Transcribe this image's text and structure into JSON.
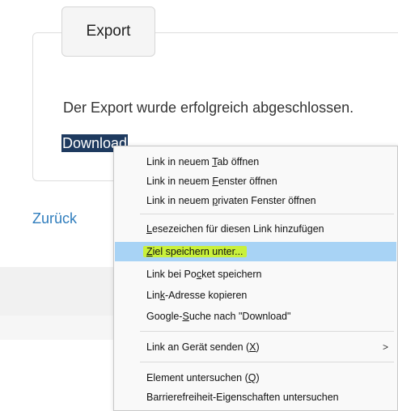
{
  "export_card": {
    "tab_label": "Export",
    "message": "Der Export wurde erfolgreich abgeschlossen.",
    "download_link": "Download"
  },
  "back_link": "Zurück",
  "context_menu": {
    "items": [
      {
        "before": "Link in neuem ",
        "accel": "T",
        "after": "ab öffnen"
      },
      {
        "before": "Link in neuem ",
        "accel": "F",
        "after": "enster öffnen"
      },
      {
        "before": "Link in neuem ",
        "accel": "p",
        "after": "rivaten Fenster öffnen"
      },
      {
        "before": "",
        "accel": "L",
        "after": "esezeichen für diesen Link hinzufügen"
      },
      {
        "before": "",
        "accel": "Z",
        "after": "iel speichern unter..."
      },
      {
        "before": "Link bei Po",
        "accel": "c",
        "after": "ket speichern"
      },
      {
        "before": "Lin",
        "accel": "k",
        "after": "-Adresse kopieren"
      },
      {
        "before": "Google-",
        "accel": "S",
        "after": "uche nach \"Download\""
      },
      {
        "before": "Link an Gerät senden (",
        "accel": "X",
        "after": ")"
      },
      {
        "before": "Element untersuchen (",
        "accel": "Q",
        "after": ")"
      },
      {
        "before": "Barrierefreiheit-Eigenschaften untersuchen",
        "accel": "",
        "after": ""
      }
    ],
    "submenu_arrow": ">",
    "highlight_color": "#c9f03a",
    "hover_color": "#a8d3f5"
  }
}
